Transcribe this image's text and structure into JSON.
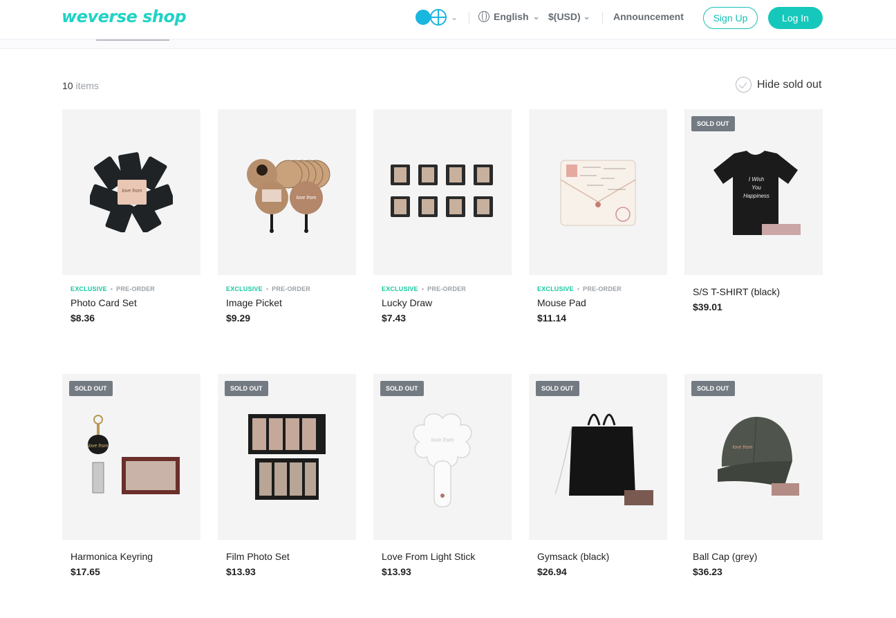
{
  "header": {
    "logo": "weverse shop",
    "language": "English",
    "currency": "$(USD)",
    "announcement": "Announcement",
    "signup_label": "Sign Up",
    "login_label": "Log In"
  },
  "toolbar": {
    "count_number": "10",
    "count_unit": "items",
    "hide_sold_out": "Hide sold out"
  },
  "products": [
    {
      "name": "Photo Card Set",
      "price": "$8.36",
      "exclusive": "EXCLUSIVE",
      "preorder": "PRE-ORDER",
      "sold_out": false
    },
    {
      "name": "Image Picket",
      "price": "$9.29",
      "exclusive": "EXCLUSIVE",
      "preorder": "PRE-ORDER",
      "sold_out": false
    },
    {
      "name": "Lucky Draw",
      "price": "$7.43",
      "exclusive": "EXCLUSIVE",
      "preorder": "PRE-ORDER",
      "sold_out": false
    },
    {
      "name": "Mouse Pad",
      "price": "$11.14",
      "exclusive": "EXCLUSIVE",
      "preorder": "PRE-ORDER",
      "sold_out": false
    },
    {
      "name": "S/S T-SHIRT (black)",
      "price": "$39.01",
      "badge": "SOLD OUT",
      "sold_out": true
    },
    {
      "name": "Harmonica Keyring",
      "price": "$17.65",
      "badge": "SOLD OUT",
      "sold_out": true
    },
    {
      "name": "Film Photo Set",
      "price": "$13.93",
      "badge": "SOLD OUT",
      "sold_out": true
    },
    {
      "name": "Love From Light Stick",
      "price": "$13.93",
      "badge": "SOLD OUT",
      "sold_out": true
    },
    {
      "name": "Gymsack (black)",
      "price": "$26.94",
      "badge": "SOLD OUT",
      "sold_out": true
    },
    {
      "name": "Ball Cap (grey)",
      "price": "$36.23",
      "badge": "SOLD OUT",
      "sold_out": true
    }
  ],
  "colors": {
    "brand": "#20d3c5",
    "exclusive": "#16c8a0",
    "sold_out_badge": "#737a82"
  }
}
